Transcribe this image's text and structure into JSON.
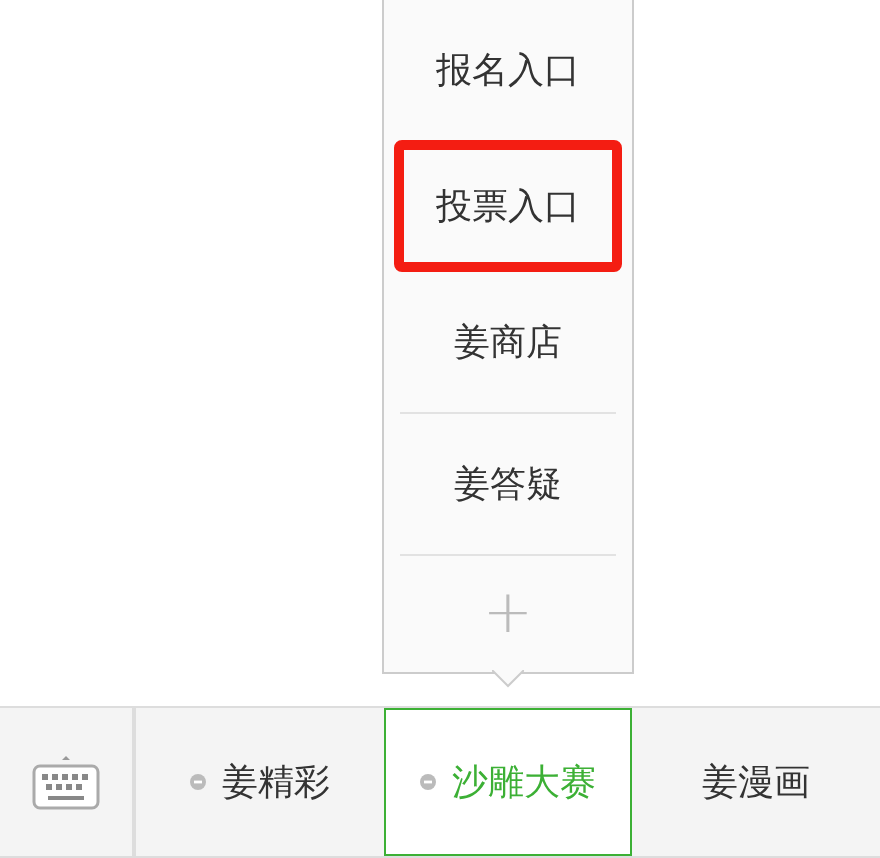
{
  "submenu": {
    "items": [
      {
        "label": "报名入口",
        "highlighted": false
      },
      {
        "label": "投票入口",
        "highlighted": true
      },
      {
        "label": "姜商店",
        "highlighted": false
      },
      {
        "label": "姜答疑",
        "highlighted": false
      }
    ],
    "add_label": "+"
  },
  "menu_bar": {
    "tabs": [
      {
        "label": "姜精彩",
        "has_submenu": true,
        "selected": false
      },
      {
        "label": "沙雕大赛",
        "has_submenu": true,
        "selected": true
      },
      {
        "label": "姜漫画",
        "has_submenu": false,
        "selected": false
      }
    ]
  }
}
